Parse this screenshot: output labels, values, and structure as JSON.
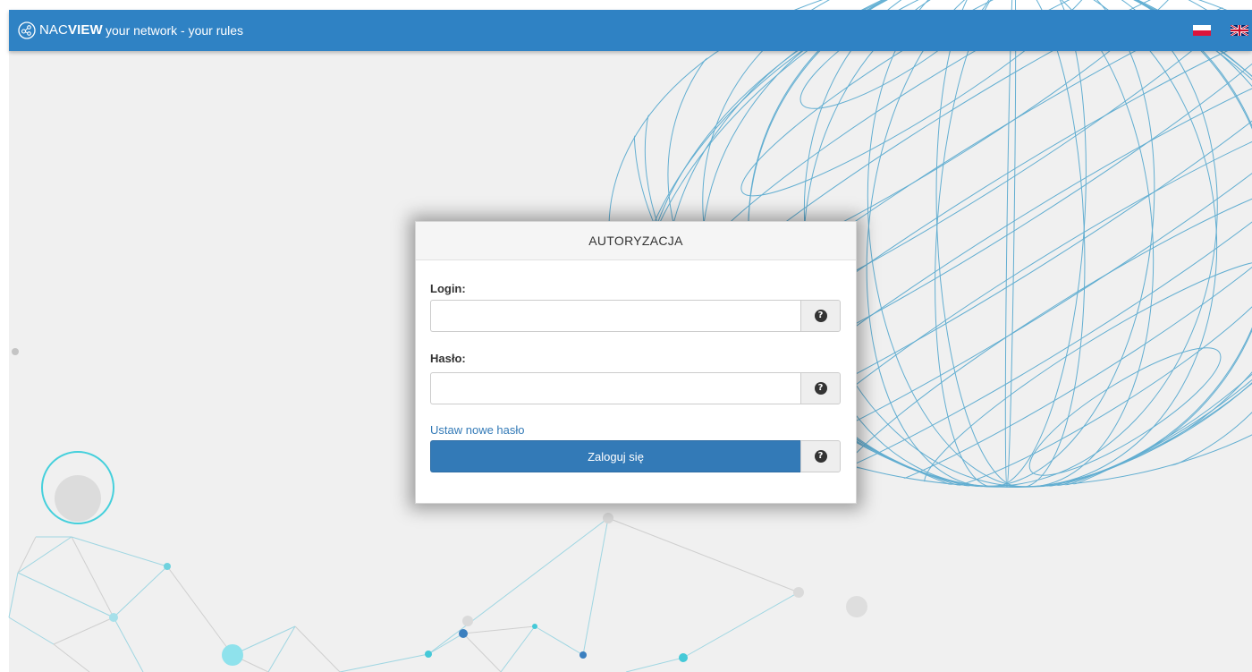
{
  "header": {
    "logo_prefix": "NAC",
    "logo_bold": "VIEW",
    "tagline": "your network - your rules",
    "brand_color": "#2f82c4"
  },
  "languages": [
    {
      "code": "pl",
      "icon": "poland-flag-icon"
    },
    {
      "code": "en",
      "icon": "uk-flag-icon"
    }
  ],
  "login_form": {
    "title": "AUTORYZACJA",
    "login_label": "Login:",
    "login_value": "",
    "password_label": "Hasło:",
    "password_value": "",
    "reset_link": "Ustaw nowe hasło",
    "submit_label": "Zaloguj się",
    "help_icon": "question-circle-icon",
    "button_color": "#337ab7",
    "link_color": "#337ab7"
  }
}
